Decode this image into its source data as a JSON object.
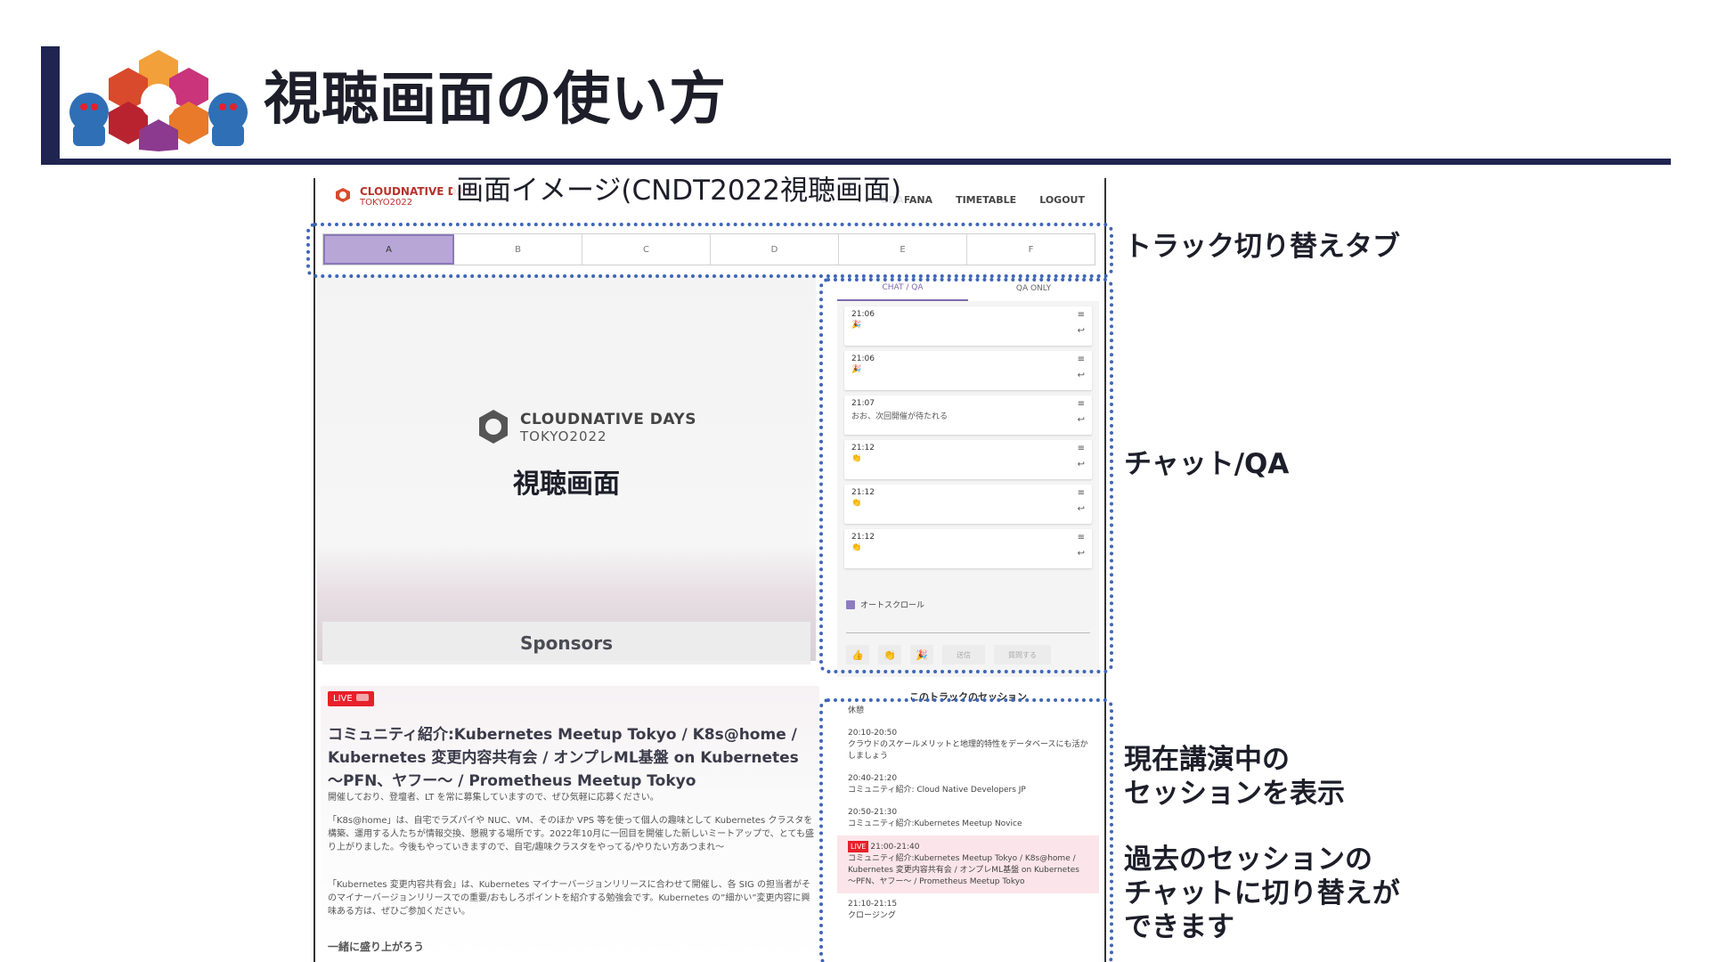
{
  "slide": {
    "title": "視聴画面の使い方",
    "logo": "cloudnative-days-tokyo-shisa-logo"
  },
  "screenshot": {
    "caption": "画面イメージ(CNDT2022視聴画面)",
    "logo_line1": "CLOUDNATIVE DAYS",
    "logo_line2": "TOKYO2022",
    "nav": [
      "GRAFANA",
      "TIMETABLE",
      "LOGOUT"
    ],
    "tracks": [
      "A",
      "B",
      "C",
      "D",
      "E",
      "F"
    ],
    "video": {
      "logo_line1": "CLOUDNATIVE DAYS",
      "logo_line2": "TOKYO2022",
      "title": "視聴画面",
      "sponsors": "Sponsors"
    },
    "chat": {
      "tabs": [
        "CHAT / QA",
        "QA ONLY"
      ],
      "messages": [
        {
          "time": "21:06",
          "body": "🎉"
        },
        {
          "time": "21:06",
          "body": "🎉"
        },
        {
          "time": "21:07",
          "body": "おお、次回開催が待たれる"
        },
        {
          "time": "21:12",
          "body": "👏"
        },
        {
          "time": "21:12",
          "body": "👏"
        },
        {
          "time": "21:12",
          "body": "👏"
        }
      ],
      "autoscroll": "オートスクロール",
      "actions": [
        "👍",
        "👏",
        "🎉"
      ],
      "send": "送信",
      "question": "質問する"
    },
    "session_info": {
      "live": "LIVE",
      "title": "コミュニティ紹介:Kubernetes Meetup Tokyo / K8s@home / Kubernetes 変更内容共有会 / オンプレML基盤 on Kubernetes 〜PFN、ヤフー〜 / Prometheus Meetup Tokyo",
      "desc1": "開催しており、登壇者、LT を常に募集していますので、ぜひ気軽に応募ください。",
      "desc2": "「K8s@home」は、自宅でラズパイや NUC、VM、そのほか VPS 等を使って個人の趣味として Kubernetes クラスタを構築、運用する人たちが情報交換、懇親する場所です。2022年10月に一回目を開催した新しいミートアップで、とても盛り上がりました。今後もやっていきますので、自宅/趣味クラスタをやってる/やりたい方あつまれ〜",
      "desc3": "「Kubernetes 変更内容共有会」は、Kubernetes マイナーバージョンリリースに合わせて開催し、各 SIG の担当者がそのマイナーバージョンリリースでの重要/おもしろポイントを紹介する勉強会です。Kubernetes の”細かい”変更内容に興味ある方は、ぜひご参加ください。",
      "desc4": "一緒に盛り上がろう"
    },
    "sessions": {
      "title": "このトラックのセッション",
      "items": [
        {
          "time": "",
          "name": "休憩"
        },
        {
          "time": "20:10-20:50",
          "name": "クラウドのスケールメリットと地理的特性をデータベースにも活かしましょう"
        },
        {
          "time": "20:40-21:20",
          "name": "コミュニティ紹介: Cloud Native Developers JP"
        },
        {
          "time": "20:50-21:30",
          "name": "コミュニティ紹介:Kubernetes Meetup Novice"
        },
        {
          "time": "21:00-21:40",
          "name": "コミュニティ紹介:Kubernetes Meetup Tokyo / K8s@home / Kubernetes 変更内容共有会 / オンプレML基盤 on Kubernetes 〜PFN、ヤフー〜 / Prometheus Meetup Tokyo",
          "live": "LIVE"
        },
        {
          "time": "21:10-21:15",
          "name": "クロージング"
        }
      ]
    }
  },
  "annotations": {
    "tracks": "トラック切り替えタブ",
    "chat": "チャット/QA",
    "current_line1": "現在講演中の",
    "current_line2": "セッションを表示",
    "past_line1": "過去のセッションの",
    "past_line2": "チャットに切り替えが",
    "past_line3": "できます"
  },
  "colors": {
    "navy": "#1f2550",
    "callout": "#3f66b8",
    "active_tab": "#b7a6d6",
    "live": "#e8202a"
  }
}
